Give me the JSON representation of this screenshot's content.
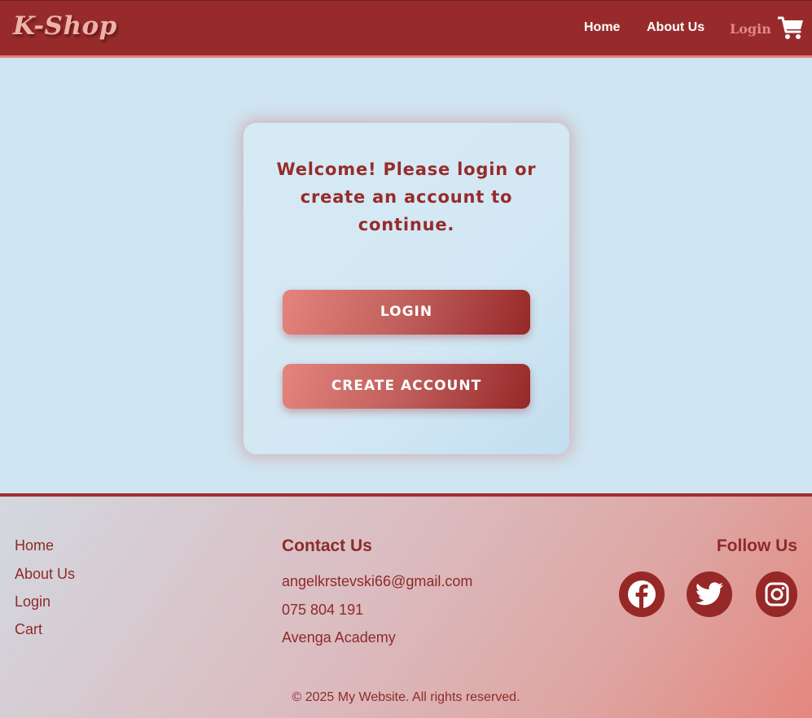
{
  "header": {
    "logo": "K-Shop",
    "nav": {
      "home": "Home",
      "about": "About Us",
      "login": "Login"
    },
    "cart_icon": "shopping-cart-icon"
  },
  "card": {
    "welcome_text": "Welcome! Please login or create an account to continue.",
    "login_button": "LOGIN",
    "create_button": "CREATE ACCOUNT"
  },
  "footer": {
    "links": {
      "home": "Home",
      "about": "About Us",
      "login": "Login",
      "cart": "Cart"
    },
    "contact": {
      "title": "Contact Us",
      "email": "angelkrstevski66@gmail.com",
      "phone": "075 804 191",
      "organization": "Avenga Academy"
    },
    "social": {
      "title": "Follow Us",
      "icons": [
        "facebook-icon",
        "twitter-icon",
        "instagram-icon"
      ]
    },
    "copyright": "© 2025 My Website. All rights reserved."
  },
  "colors": {
    "primary": "#972b2b",
    "accent": "#e5847d",
    "background": "#cfe5f1"
  }
}
